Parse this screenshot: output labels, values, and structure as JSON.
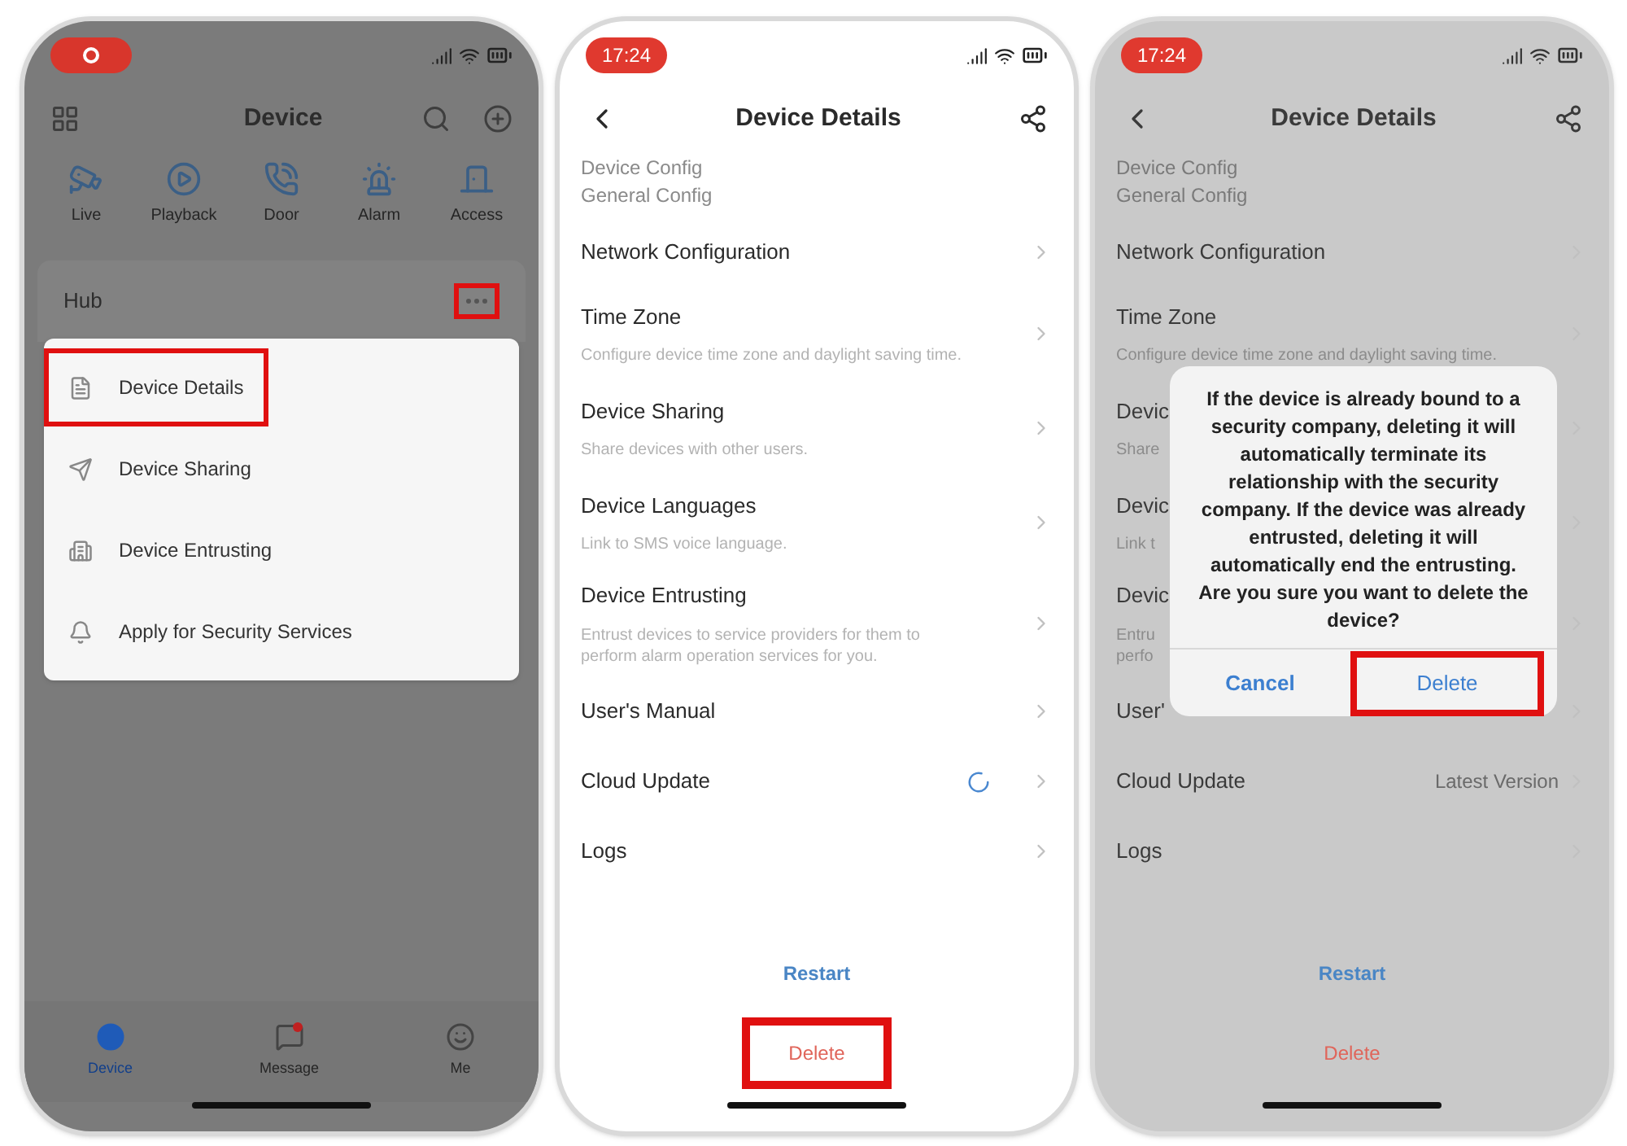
{
  "home_screen": {
    "title": "Device",
    "shortcuts": [
      {
        "kind": "camera",
        "label": "Live"
      },
      {
        "kind": "playback",
        "label": "Playback"
      },
      {
        "kind": "door",
        "label": "Door"
      },
      {
        "kind": "alarm",
        "label": "Alarm"
      },
      {
        "kind": "access",
        "label": "Access"
      }
    ],
    "group": {
      "name": "Hub",
      "more_highlighted": true
    },
    "menu": [
      {
        "kind": "details",
        "label": "Device Details",
        "highlighted": true
      },
      {
        "kind": "sharing",
        "label": "Device Sharing",
        "highlighted": false
      },
      {
        "kind": "entrusting",
        "label": "Device Entrusting",
        "highlighted": false
      },
      {
        "kind": "security",
        "label": "Apply for Security Services",
        "highlighted": false
      }
    ],
    "tabs": [
      {
        "kind": "device",
        "label": "Device",
        "selected": true,
        "badge": false
      },
      {
        "kind": "message",
        "label": "Message",
        "selected": false,
        "badge": true
      },
      {
        "kind": "me",
        "label": "Me",
        "selected": false,
        "badge": false
      }
    ]
  },
  "details_screen": {
    "time": "17:24",
    "title": "Device Details",
    "sections": [
      "Device Config",
      "General Config"
    ],
    "rows": [
      {
        "title": "Network Configuration"
      },
      {
        "title": "Time Zone",
        "description": "Configure device time zone and daylight saving time."
      },
      {
        "title": "Device Sharing",
        "description": "Share devices with other users."
      },
      {
        "title": "Device Languages",
        "description": "Link to SMS voice language."
      },
      {
        "title": "Device Entrusting",
        "description": "Entrust devices to service providers for them to perform alarm operation services for you."
      },
      {
        "title": "User's Manual"
      },
      {
        "title": "Cloud Update",
        "loading": true
      },
      {
        "title": "Logs"
      }
    ],
    "restart": "Restart",
    "delete": {
      "label": "Delete",
      "highlighted": true
    }
  },
  "confirm_screen": {
    "time": "17:24",
    "title": "Device Details",
    "sections": [
      "Device Config",
      "General Config"
    ],
    "rows": [
      {
        "title": "Network Configuration"
      },
      {
        "title": "Time Zone",
        "description": "Configure device time zone and daylight saving time."
      },
      {
        "title": "Devic",
        "description": "Share"
      },
      {
        "title": "Devic",
        "description": "Link t"
      },
      {
        "title": "Devic",
        "description": "Entru\nperfo"
      },
      {
        "title": "User'"
      },
      {
        "title": "Cloud Update",
        "value": "Latest Version"
      },
      {
        "title": "Logs"
      }
    ],
    "restart": "Restart",
    "delete": {
      "label": "Delete",
      "highlighted": false
    },
    "dialog": {
      "message": "If the device is already bound to a security company, deleting it will automatically terminate its relationship with the security company. If the device was already entrusted, deleting it will automatically end the entrusting. Are you sure you want to delete the device?",
      "cancel": "Cancel",
      "confirm": {
        "label": "Delete",
        "highlighted": true
      }
    }
  }
}
